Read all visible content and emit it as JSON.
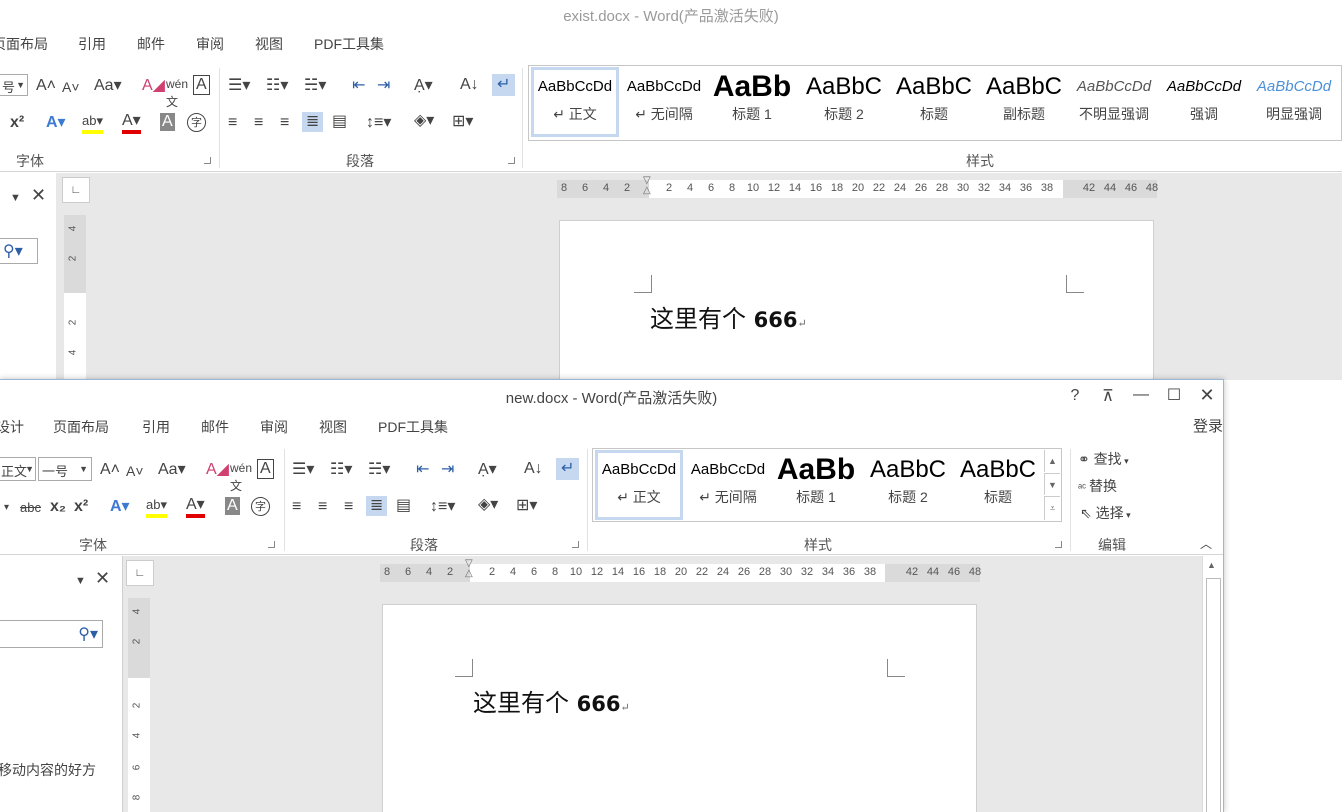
{
  "back": {
    "title": "exist.docx - Word(产品激活失败)",
    "tabs": [
      "页面布局",
      "引用",
      "邮件",
      "审阅",
      "视图",
      "PDF工具集"
    ],
    "tab_left_partial": "页面布局",
    "size_partial": "号",
    "groups": {
      "font": "字体",
      "paragraph": "段落",
      "styles": "样式"
    },
    "styles": [
      {
        "preview": "AaBbCcDd",
        "name": "↵ 正文"
      },
      {
        "preview": "AaBbCcDd",
        "name": "↵ 无间隔"
      },
      {
        "preview": "AaBb",
        "name": "标题 1"
      },
      {
        "preview": "AaBbC",
        "name": "标题 2"
      },
      {
        "preview": "AaBbC",
        "name": "标题"
      },
      {
        "preview": "AaBbC",
        "name": "副标题"
      },
      {
        "preview": "AaBbCcDd",
        "name": "不明显强调"
      },
      {
        "preview": "AaBbCcDd",
        "name": "强调"
      },
      {
        "preview": "AaBbCcDd",
        "name": "明显强调"
      }
    ],
    "ruler_ticks": [
      "8",
      "6",
      "4",
      "2",
      "",
      "2",
      "4",
      "6",
      "8",
      "10",
      "12",
      "14",
      "16",
      "18",
      "20",
      "22",
      "24",
      "26",
      "28",
      "30",
      "32",
      "34",
      "36",
      "38",
      "",
      "42",
      "44",
      "46",
      "48"
    ],
    "vruler_ticks": [
      "4",
      "2",
      "",
      "2",
      "4"
    ],
    "doc_text_cn": "这里有个 ",
    "doc_text_num": "666",
    "para_mark": "↵"
  },
  "front": {
    "title": "new.docx - Word(产品激活失败)",
    "tabs": [
      "设计",
      "页面布局",
      "引用",
      "邮件",
      "审阅",
      "视图",
      "PDF工具集"
    ],
    "login": "登录",
    "font_partial": "正文",
    "size": "一号",
    "groups": {
      "font": "字体",
      "paragraph": "段落",
      "styles": "样式",
      "editing": "编辑"
    },
    "styles": [
      {
        "preview": "AaBbCcDd",
        "name": "↵ 正文"
      },
      {
        "preview": "AaBbCcDd",
        "name": "↵ 无间隔"
      },
      {
        "preview": "AaBb",
        "name": "标题 1"
      },
      {
        "preview": "AaBbC",
        "name": "标题 2"
      },
      {
        "preview": "AaBbC",
        "name": "标题"
      }
    ],
    "editing": {
      "find": "查找",
      "replace": "替换",
      "select": "选择"
    },
    "ruler_ticks": [
      "8",
      "6",
      "4",
      "2",
      "",
      "2",
      "4",
      "6",
      "8",
      "10",
      "12",
      "14",
      "16",
      "18",
      "20",
      "22",
      "24",
      "26",
      "28",
      "30",
      "32",
      "34",
      "36",
      "38",
      "",
      "42",
      "44",
      "46",
      "48"
    ],
    "vruler_ticks": [
      "4",
      "2",
      "",
      "2",
      "4",
      "6",
      "8"
    ],
    "doc_text_cn": "这里有个 ",
    "doc_text_num": "666",
    "para_mark": "↵",
    "nav_hint": "移动内容的好方",
    "help": "?"
  },
  "colors": {
    "highlight": "#ffff00",
    "font_red": "#e00000",
    "selected_blue": "#c5d8ef"
  }
}
